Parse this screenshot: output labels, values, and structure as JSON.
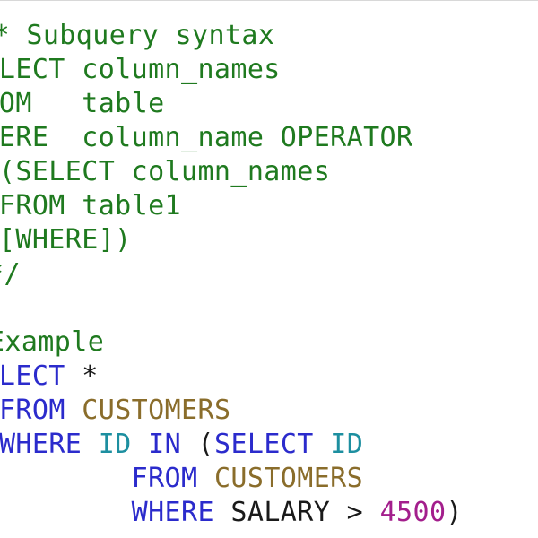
{
  "code": {
    "comment_lines": [
      "/* Subquery syntax",
      "SELECT column_names",
      "FROM   table",
      "WHERE  column_name OPERATOR",
      "  (SELECT column_names",
      "  FROM table1",
      "  [WHERE])",
      "*/",
      "",
      "--Example"
    ],
    "example": {
      "select_kw": "SELECT",
      "star": "*",
      "from_kw": "FROM",
      "table1": "CUSTOMERS",
      "where_kw": "WHERE",
      "col_id": "ID",
      "in_kw": "IN",
      "open_paren": "(",
      "sub_select_kw": "SELECT",
      "sub_col_id": "ID",
      "sub_from_kw": "FROM",
      "sub_table": "CUSTOMERS",
      "sub_where_kw": "WHERE",
      "salary_col": "SALARY",
      "gt": ">",
      "value": "4500",
      "close_paren": ")"
    }
  },
  "colors": {
    "comment": "#1f7a1f",
    "keyword": "#2b2bcc",
    "table": "#8a6d2b",
    "identifier": "#1d8fa0",
    "number": "#a31e8c",
    "plain": "#1a1a1a"
  }
}
